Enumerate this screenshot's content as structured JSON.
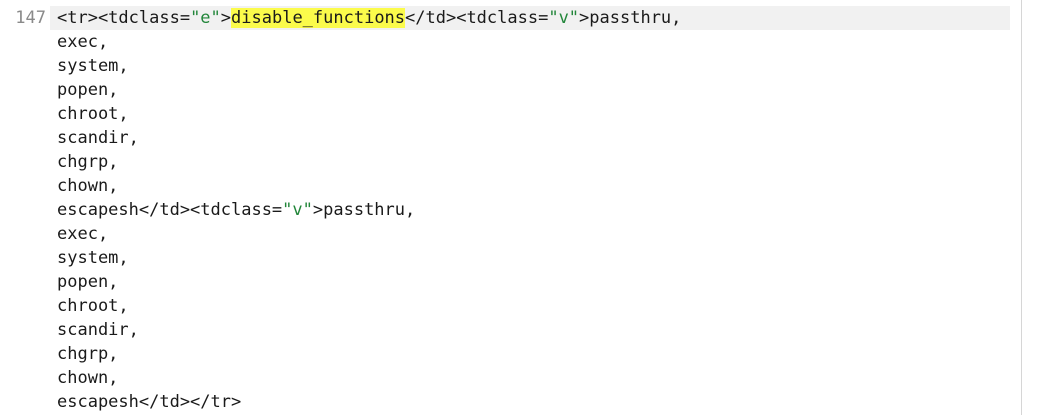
{
  "editor": {
    "line_number": "147",
    "first_line": {
      "part1": "<tr><tdclass=",
      "str1": "\"e\"",
      "part2": ">",
      "highlight": "disable_functions",
      "part3": "</td><tdclass=",
      "str2": "\"v\"",
      "part4": ">passthru,"
    },
    "lines_a": [
      "exec,",
      "system,",
      "popen,",
      "chroot,",
      "scandir,",
      "chgrp,",
      "chown,"
    ],
    "escape_line": {
      "part1": "escapesh</td><tdclass=",
      "str1": "\"v\"",
      "part2": ">passthru,"
    },
    "lines_b": [
      "exec,",
      "system,",
      "popen,",
      "chroot,",
      "scandir,",
      "chgrp,",
      "chown,"
    ],
    "last_line": "escapesh</td></tr>"
  },
  "colors": {
    "highlight": "#fbfb4b",
    "string": "#22863a",
    "current_line": "#f1f1f1"
  }
}
